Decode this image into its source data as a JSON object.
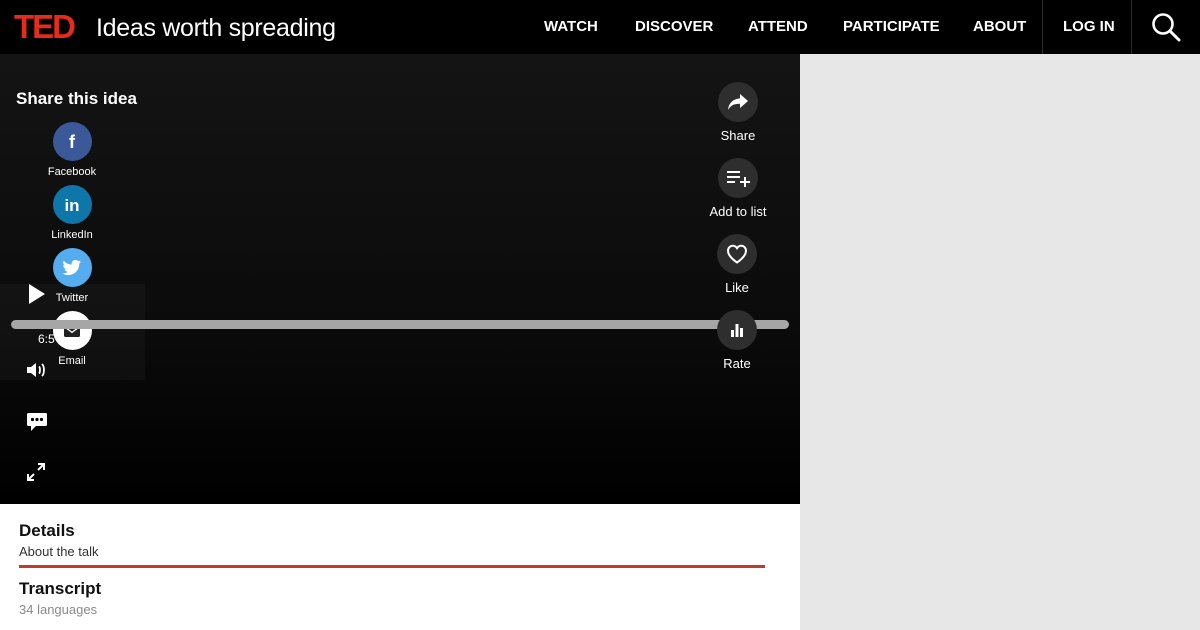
{
  "header": {
    "logo": "TED",
    "tagline": "Ideas worth spreading",
    "nav": [
      "WATCH",
      "DISCOVER",
      "ATTEND",
      "PARTICIPATE",
      "ABOUT"
    ],
    "login": "LOG IN"
  },
  "share": {
    "title": "Share this idea",
    "items": [
      {
        "label": "Facebook",
        "icon": "facebook-icon",
        "color": "#3b5998"
      },
      {
        "label": "LinkedIn",
        "icon": "linkedin-icon",
        "color": "#0e76a8"
      },
      {
        "label": "Twitter",
        "icon": "twitter-icon",
        "color": "#55acee"
      },
      {
        "label": "Email",
        "icon": "email-icon",
        "color": "#ffffff"
      }
    ]
  },
  "player": {
    "time": "6:5",
    "progress": 0
  },
  "actions": [
    {
      "label": "Share",
      "icon": "share-icon"
    },
    {
      "label": "Add to list",
      "icon": "add-to-list-icon"
    },
    {
      "label": "Like",
      "icon": "heart-icon"
    },
    {
      "label": "Rate",
      "icon": "bar-chart-icon"
    }
  ],
  "details": {
    "title": "Details",
    "subtitle": "About the talk",
    "accent": "#c23a2b"
  },
  "transcript": {
    "title": "Transcript",
    "subtitle": "34 languages"
  }
}
